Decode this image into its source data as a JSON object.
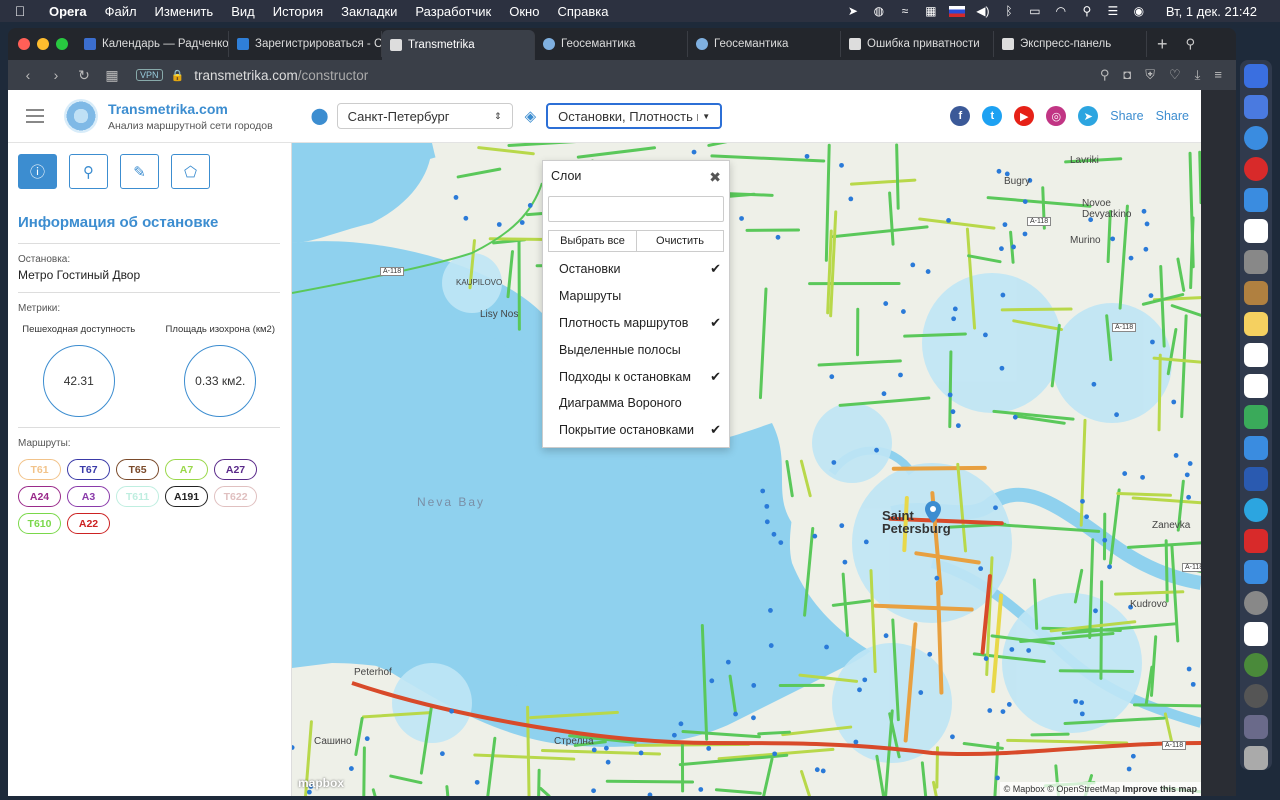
{
  "menubar": {
    "app": "Opera",
    "items": [
      "Файл",
      "Изменить",
      "Вид",
      "История",
      "Закладки",
      "Разработчик",
      "Окно",
      "Справка"
    ],
    "clock": "Вт, 1 дек.  21:42"
  },
  "browser": {
    "tabs": [
      {
        "label": "Календарь — Радченко А",
        "color": "#3b6ecf"
      },
      {
        "label": "Зарегистрироваться - Co",
        "color": "#2f7fd8"
      },
      {
        "label": "Transmetrika",
        "color": "#ddd"
      },
      {
        "label": "Геосемантика",
        "color": "#7fb0e0"
      },
      {
        "label": "Геосемантика",
        "color": "#7fb0e0"
      },
      {
        "label": "Ошибка приватности",
        "color": "#ddd"
      },
      {
        "label": "Экспресс-панель",
        "color": "#ddd"
      }
    ],
    "url_host": "transmetrika.com",
    "url_path": "/constructor",
    "vpn": "VPN"
  },
  "header": {
    "brand_name": "Transmetrika.com",
    "brand_sub": "Анализ маршрутной сети городов",
    "city": "Санкт-Петербург",
    "layers_value": "Остановки, Плотность мар",
    "share1": "Share",
    "share2": "Share"
  },
  "panel": {
    "title": "Информация об остановке",
    "stop_label": "Остановка:",
    "stop_value": "Метро Гостиный Двор",
    "metrics_label": "Метрики:",
    "metric1_title": "Пешеходная доступность",
    "metric1_value": "42.31",
    "metric2_title": "Площадь изохрона (км2)",
    "metric2_value": "0.33 км2.",
    "routes_label": "Маршруты:",
    "routes": [
      {
        "name": "Т61",
        "color": "#f2c38a"
      },
      {
        "name": "Т67",
        "color": "#3a3aa8"
      },
      {
        "name": "Т65",
        "color": "#7a4a2a"
      },
      {
        "name": "А7",
        "color": "#9ad84a"
      },
      {
        "name": "А27",
        "color": "#5a2a8a"
      },
      {
        "name": "А24",
        "color": "#9a2a8a"
      },
      {
        "name": "А3",
        "color": "#8a3aaa"
      },
      {
        "name": "Т611",
        "color": "#bfeee0"
      },
      {
        "name": "А191",
        "color": "#222222"
      },
      {
        "name": "Т622",
        "color": "#e0c0c0"
      },
      {
        "name": "Т610",
        "color": "#7ad84a"
      },
      {
        "name": "А22",
        "color": "#cc2222"
      }
    ]
  },
  "dropdown": {
    "title": "Слои",
    "select_all": "Выбрать все",
    "clear": "Очистить",
    "items": [
      {
        "label": "Остановки",
        "checked": "✔"
      },
      {
        "label": "Маршруты",
        "checked": ""
      },
      {
        "label": "Плотность маршрутов",
        "checked": "✔"
      },
      {
        "label": "Выделенные полосы",
        "checked": ""
      },
      {
        "label": "Подходы к остановкам",
        "checked": "✔"
      },
      {
        "label": "Диаграмма Вороного",
        "checked": ""
      },
      {
        "label": "Покрытие остановками",
        "checked": "✔"
      }
    ]
  },
  "map": {
    "labels": {
      "neva_bay": "Neva Bay",
      "lisy_nos": "Lisy Nos",
      "kaupilovo": "KAUPILOVO",
      "lavriki": "Lavriki",
      "bugry": "Bugry",
      "novoe_devyatkino": "Novoe Devyatkino",
      "murino": "Murino",
      "saint_petersburg": "Saint Petersburg",
      "zanevka": "Zanevka",
      "kudrovo": "Kudrovo",
      "peterhof": "Peterhof",
      "sashino": "Сашино",
      "strelna": "Стрелна"
    },
    "shields": {
      "a118_west": "А-118",
      "a118_north": "А-118",
      "a118_east": "А-118",
      "a118_southeast": "А-118",
      "a118_south": "А-118"
    },
    "attribution": "© Mapbox © OpenStreetMap",
    "improve": "Improve this map",
    "logo": "mapbox"
  }
}
